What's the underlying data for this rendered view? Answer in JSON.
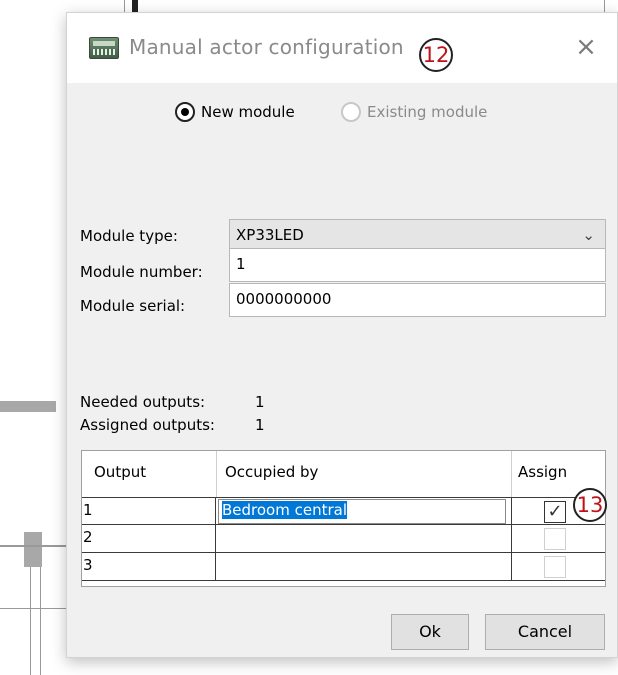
{
  "dialog": {
    "title": "Manual actor configuration",
    "close_glyph": "×",
    "callout_title": "12",
    "callout_grid": "13"
  },
  "mode": {
    "new_label": "New module",
    "new_selected": true,
    "existing_label": "Existing module",
    "existing_enabled": false
  },
  "form": {
    "module_type_label": "Module type:",
    "module_type_value": "XP33LED",
    "module_number_label": "Module number:",
    "module_number_value": "1",
    "module_serial_label": "Module serial:",
    "module_serial_value": "0000000000"
  },
  "outputs": {
    "needed_label": "Needed outputs:",
    "needed_value": "1",
    "assigned_label": "Assigned outputs:",
    "assigned_value": "1"
  },
  "grid": {
    "headers": [
      "Output",
      "Occupied by",
      "Assign"
    ],
    "rows": [
      {
        "output": "1",
        "occupied_by": "Bedroom central",
        "assign": true
      },
      {
        "output": "2",
        "occupied_by": "",
        "assign": false
      },
      {
        "output": "3",
        "occupied_by": "",
        "assign": false
      }
    ]
  },
  "buttons": {
    "ok": "Ok",
    "cancel": "Cancel"
  },
  "icons": {
    "app": "module-icon",
    "close": "close-icon",
    "combo_arrow": "chevron-down-icon",
    "check": "checkmark-icon"
  }
}
